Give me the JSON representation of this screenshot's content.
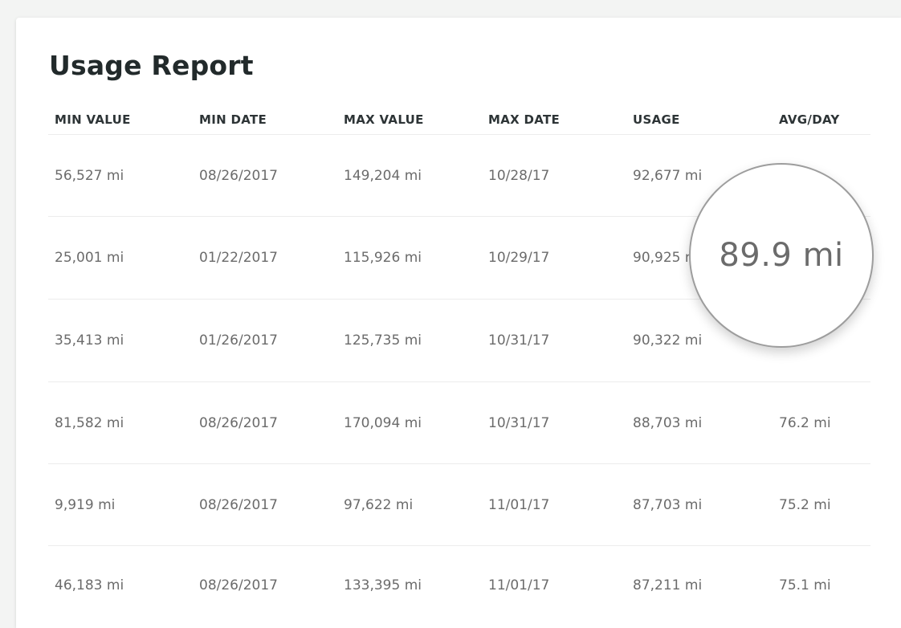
{
  "report": {
    "title": "Usage Report",
    "columns": [
      "MIN VALUE",
      "MIN DATE",
      "MAX VALUE",
      "MAX DATE",
      "USAGE",
      "AVG/DAY"
    ],
    "rows": [
      [
        "56,527 mi",
        "08/26/2017",
        "149,204 mi",
        "10/28/17",
        "92,677 mi",
        ""
      ],
      [
        "25,001 mi",
        "01/22/2017",
        "115,926 mi",
        "10/29/17",
        "90,925 mi",
        ""
      ],
      [
        "35,413 mi",
        "01/26/2017",
        "125,735 mi",
        "10/31/17",
        "90,322 mi",
        ""
      ],
      [
        "81,582 mi",
        "08/26/2017",
        "170,094 mi",
        "10/31/17",
        "88,703 mi",
        "76.2 mi"
      ],
      [
        "9,919 mi",
        "08/26/2017",
        "97,622 mi",
        "11/01/17",
        "87,703 mi",
        "75.2 mi"
      ],
      [
        "46,183 mi",
        "08/26/2017",
        "133,395 mi",
        "11/01/17",
        "87,211 mi",
        "75.1 mi"
      ]
    ]
  },
  "magnifier": {
    "value": "89.9 mi"
  }
}
